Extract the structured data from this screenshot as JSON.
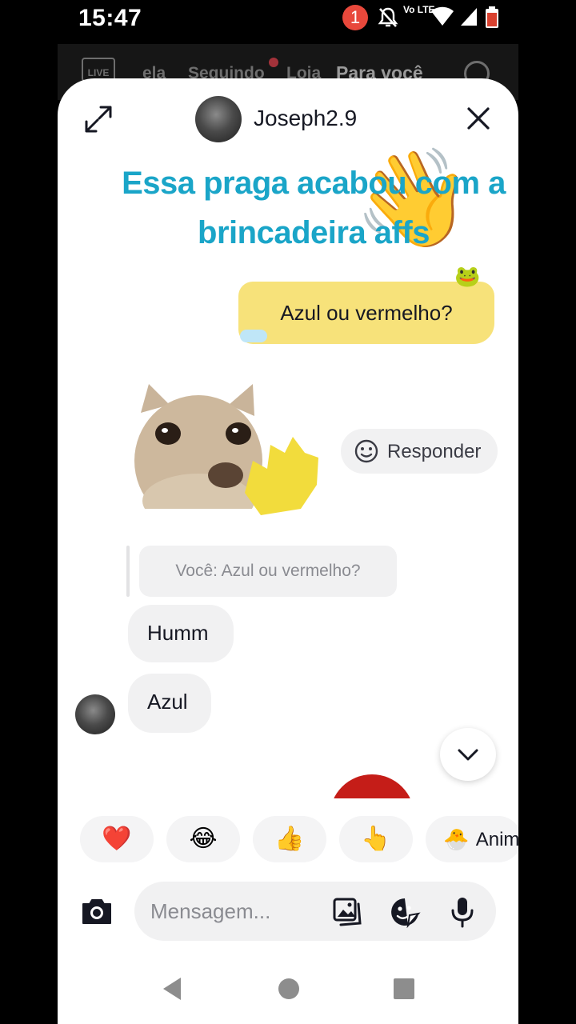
{
  "status_bar": {
    "time": "15:47",
    "notification_count": "1",
    "network_label": "Vo LTE"
  },
  "background_feed": {
    "nav": [
      "LIVE",
      "ela",
      "Seguindo",
      "Loja",
      "Para você"
    ]
  },
  "chat": {
    "contact_name": "Joseph2.9",
    "sticker_text": "Essa praga acabou com a brincadeira affs",
    "my_message": "Azul ou vermelho?",
    "reply_label": "Responder",
    "quoted_message": "Você: Azul ou vermelho?",
    "replies": [
      "Humm",
      "Azul"
    ]
  },
  "reactions": [
    {
      "emoji": "❤️",
      "label": ""
    },
    {
      "emoji": "😂",
      "label": ""
    },
    {
      "emoji": "👍",
      "label": ""
    },
    {
      "emoji": "👆",
      "label": ""
    },
    {
      "emoji": "🐣",
      "label": "Anim"
    }
  ],
  "composer": {
    "placeholder": "Mensagem..."
  },
  "colors": {
    "sticker_text": "#1aa5c8",
    "my_bubble": "#f7e27a",
    "notification_badge": "#e8483b"
  },
  "icons": [
    "expand-icon",
    "close-icon",
    "smiley-icon",
    "chevron-down-icon",
    "camera-icon",
    "gallery-icon",
    "sticker-icon",
    "microphone-icon"
  ]
}
